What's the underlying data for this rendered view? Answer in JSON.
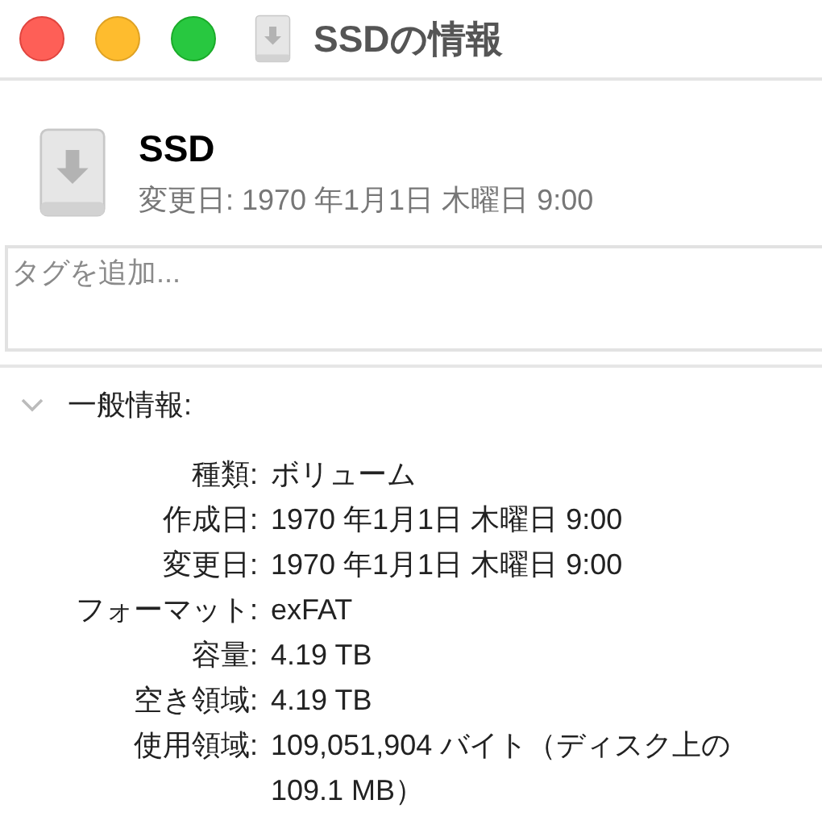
{
  "window": {
    "title": "SSDの情報"
  },
  "header": {
    "name": "SSD",
    "modified": "変更日: 1970 年1月1日 木曜日 9:00"
  },
  "tags": {
    "placeholder": "タグを追加..."
  },
  "general": {
    "title": "一般情報:",
    "expanded": true,
    "rows": [
      {
        "label": "種類:",
        "value": "ボリューム"
      },
      {
        "label": "作成日:",
        "value": "1970 年1月1日 木曜日 9:00"
      },
      {
        "label": "変更日:",
        "value": "1970 年1月1日 木曜日 9:00"
      },
      {
        "label": "フォーマット:",
        "value": "exFAT"
      },
      {
        "label": "容量:",
        "value": "4.19 TB"
      },
      {
        "label": "空き領域:",
        "value": "4.19 TB"
      },
      {
        "label": "使用領域:",
        "value": "109,051,904 バイト（ディスク上の109.1 MB）"
      }
    ]
  }
}
